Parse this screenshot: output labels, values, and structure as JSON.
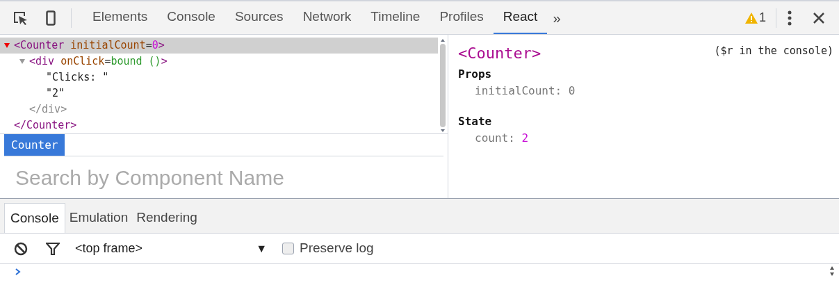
{
  "toolbar": {
    "tabs": [
      {
        "label": "Elements",
        "selected": false
      },
      {
        "label": "Console",
        "selected": false
      },
      {
        "label": "Sources",
        "selected": false
      },
      {
        "label": "Network",
        "selected": false
      },
      {
        "label": "Timeline",
        "selected": false
      },
      {
        "label": "Profiles",
        "selected": false
      },
      {
        "label": "React",
        "selected": true
      }
    ],
    "overflow": "»",
    "warning_count": "1"
  },
  "tree": [
    {
      "kind": "element",
      "open": "<Counter",
      "attrs": [
        {
          "name": "initialCount",
          "sep": "=",
          "value": "0",
          "kind": "number"
        }
      ],
      "open_end": ">",
      "close": "</Counter>",
      "expanded": true,
      "selected": true,
      "children": [
        {
          "kind": "element",
          "open": "<div",
          "attrs": [
            {
              "name": "onClick",
              "sep": "=",
              "value": "bound ()",
              "kind": "function"
            }
          ],
          "open_end": ">",
          "close": "</div>",
          "expanded": true,
          "selected": false,
          "children": [
            {
              "kind": "text",
              "text": "\"Clicks: \""
            },
            {
              "kind": "text",
              "text": "\"2\""
            }
          ]
        }
      ]
    }
  ],
  "breadcrumbs": [
    {
      "label": "Counter",
      "selected": true
    }
  ],
  "search": {
    "placeholder": "Search by Component Name"
  },
  "details": {
    "title": "<Counter>",
    "hint": "($r in the console)",
    "sections": [
      {
        "heading": "Props",
        "entries": [
          {
            "key": "initialCount:",
            "value": "0",
            "kind": "plain"
          }
        ]
      },
      {
        "heading": "State",
        "entries": [
          {
            "key": "count:",
            "value": "2",
            "kind": "number"
          }
        ]
      }
    ]
  },
  "drawer": {
    "tabs": [
      {
        "label": "Console",
        "selected": true
      },
      {
        "label": "Emulation",
        "selected": false
      },
      {
        "label": "Rendering",
        "selected": false
      }
    ],
    "frame_select": "<top frame>",
    "frame_arrow": "▼",
    "preserve_log": {
      "label": "Preserve log",
      "checked": false
    }
  }
}
